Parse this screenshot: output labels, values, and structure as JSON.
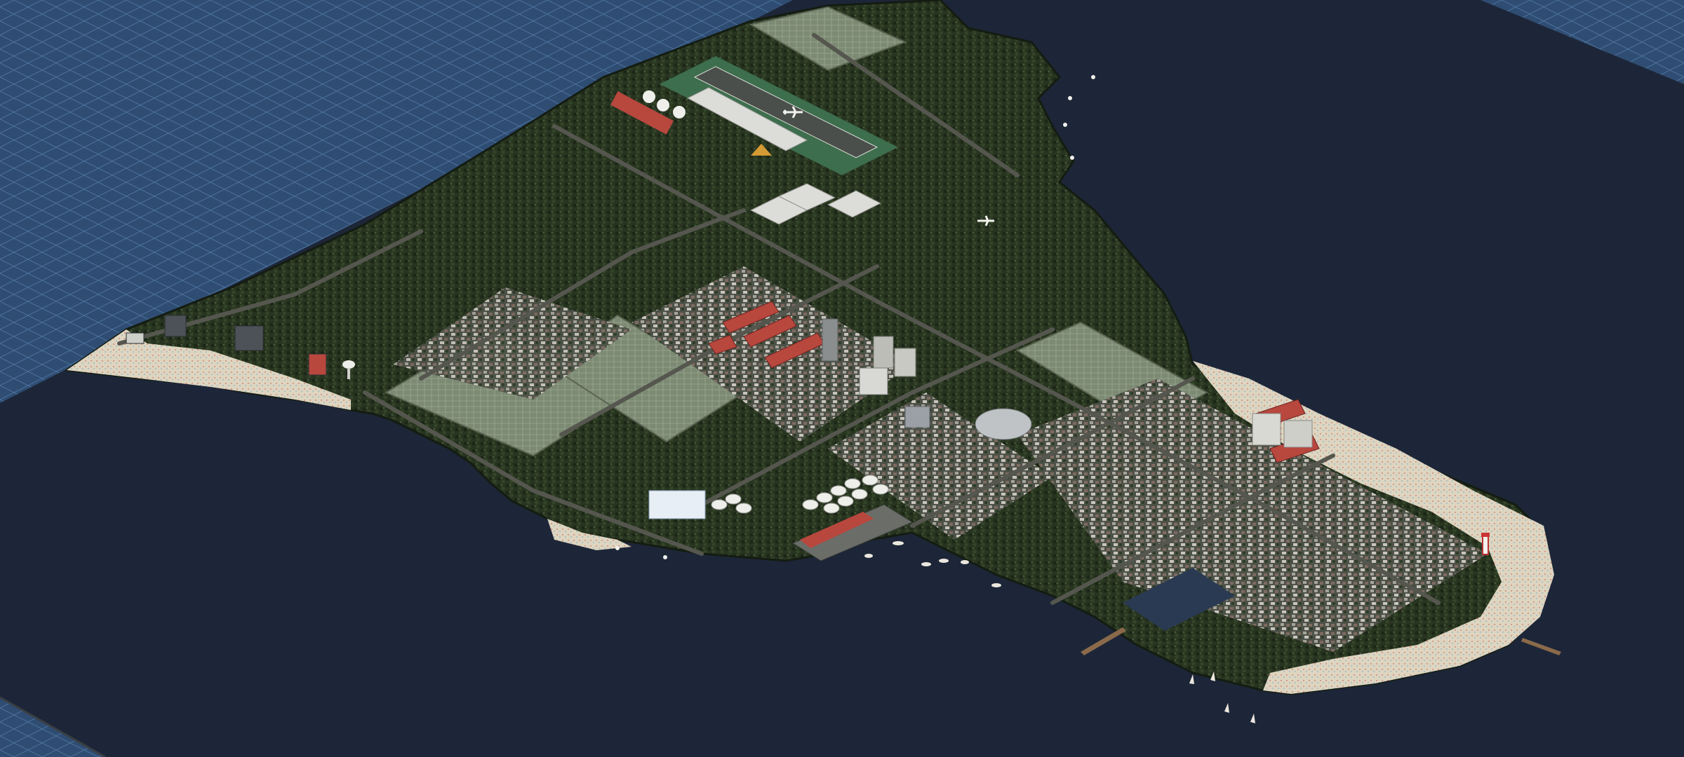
{
  "colors": {
    "deep_sea": "#1c2537",
    "deep_sea_light": "#222d42",
    "map_edge_water": "#2e4c72",
    "grid_line": "#5d86b3",
    "forest": "#25321f",
    "forest_light": "#3b4a2c",
    "beach": "#ddd4bd",
    "road": "#53554f",
    "farm_field": "#78866f",
    "runway": "#4a4f4b",
    "building_red": "#b8473e",
    "building_white": "#dcdcd8",
    "building_grey": "#8b8e8f",
    "tank_white": "#eeeeea"
  },
  "icons": {
    "airplane": "airplane-icon",
    "boat": "boat-icon",
    "buoy": "buoy-icon",
    "storage_tank": "storage-tank-icon",
    "lighthouse": "lighthouse-icon"
  }
}
